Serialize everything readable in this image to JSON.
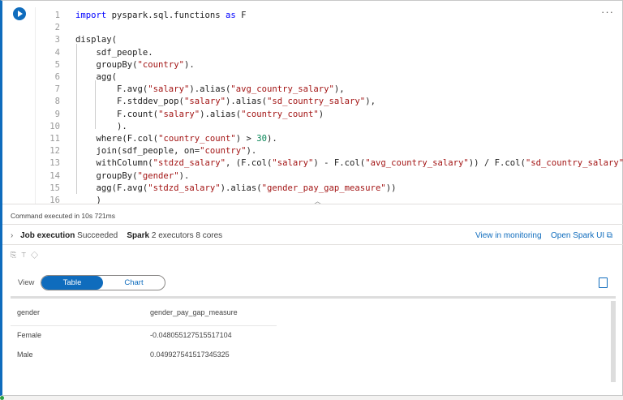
{
  "cell": {
    "more_label": "···",
    "collapse_icon": "chevron-up"
  },
  "code": [
    [
      [
        "kw",
        "import"
      ],
      [
        "pl",
        " pyspark.sql.functions "
      ],
      [
        "kw",
        "as"
      ],
      [
        "pl",
        " F"
      ]
    ],
    [],
    [
      [
        "pl",
        "display("
      ]
    ],
    [
      [
        "pl",
        "    sdf_people."
      ]
    ],
    [
      [
        "pl",
        "    groupBy("
      ],
      [
        "str",
        "\"country\""
      ],
      [
        "pl",
        ")."
      ]
    ],
    [
      [
        "pl",
        "    agg("
      ]
    ],
    [
      [
        "pl",
        "        F.avg("
      ],
      [
        "str",
        "\"salary\""
      ],
      [
        "pl",
        ").alias("
      ],
      [
        "str",
        "\"avg_country_salary\""
      ],
      [
        "pl",
        "),"
      ]
    ],
    [
      [
        "pl",
        "        F.stddev_pop("
      ],
      [
        "str",
        "\"salary\""
      ],
      [
        "pl",
        ").alias("
      ],
      [
        "str",
        "\"sd_country_salary\""
      ],
      [
        "pl",
        "),"
      ]
    ],
    [
      [
        "pl",
        "        F.count("
      ],
      [
        "str",
        "\"salary\""
      ],
      [
        "pl",
        ").alias("
      ],
      [
        "str",
        "\"country_count\""
      ],
      [
        "pl",
        ")"
      ]
    ],
    [
      [
        "pl",
        "        )."
      ]
    ],
    [
      [
        "pl",
        "    where(F.col("
      ],
      [
        "str",
        "\"country_count\""
      ],
      [
        "pl",
        ") > "
      ],
      [
        "num",
        "30"
      ],
      [
        "pl",
        ")."
      ]
    ],
    [
      [
        "pl",
        "    join(sdf_people, on="
      ],
      [
        "str",
        "\"country\""
      ],
      [
        "pl",
        ")."
      ]
    ],
    [
      [
        "pl",
        "    withColumn("
      ],
      [
        "str",
        "\"stdzd_salary\""
      ],
      [
        "pl",
        ", (F.col("
      ],
      [
        "str",
        "\"salary\""
      ],
      [
        "pl",
        ") - F.col("
      ],
      [
        "str",
        "\"avg_country_salary\""
      ],
      [
        "pl",
        ")) / F.col("
      ],
      [
        "str",
        "\"sd_country_salary\""
      ],
      [
        "pl",
        "))."
      ]
    ],
    [
      [
        "pl",
        "    groupBy("
      ],
      [
        "str",
        "\"gender\""
      ],
      [
        "pl",
        ")."
      ]
    ],
    [
      [
        "pl",
        "    agg(F.avg("
      ],
      [
        "str",
        "\"stdzd_salary\""
      ],
      [
        "pl",
        ").alias("
      ],
      [
        "str",
        "\"gender_pay_gap_measure\""
      ],
      [
        "pl",
        "))"
      ]
    ],
    [
      [
        "pl",
        "    )"
      ]
    ]
  ],
  "status": "Command executed in 10s 721ms",
  "job": {
    "label": "Job execution",
    "state": "Succeeded",
    "spark_label": "Spark",
    "spark_info": "2 executors 8 cores"
  },
  "links": {
    "monitoring": "View in monitoring",
    "spark_ui": "Open Spark UI ⧉"
  },
  "view": {
    "label": "View",
    "table": "Table",
    "chart": "Chart",
    "selected": "Table"
  },
  "table": {
    "columns": [
      "gender",
      "gender_pay_gap_measure"
    ],
    "rows": [
      [
        "Female",
        "-0.048055127515517104"
      ],
      [
        "Male",
        "0.049927541517345325"
      ]
    ]
  }
}
